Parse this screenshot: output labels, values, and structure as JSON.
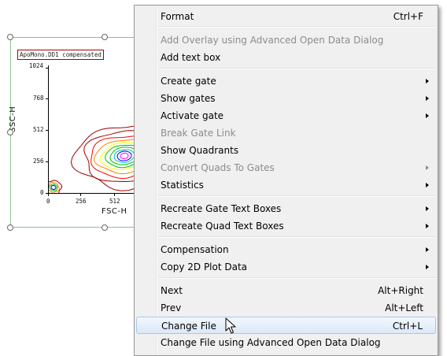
{
  "plot": {
    "title": "ApoMono.DD1 compensated",
    "xlabel": "FSC-H",
    "ylabel": "SSC-H",
    "x_ticks": [
      "0",
      "256",
      "512"
    ],
    "y_ticks": [
      "1024",
      "768",
      "512",
      "256",
      "0"
    ],
    "contour_colors": [
      "#a00000",
      "#ff0000",
      "#ff8000",
      "#ffff00",
      "#00c000",
      "#00c0c0",
      "#0000ff",
      "#ff00ff"
    ]
  },
  "menu": {
    "items": [
      {
        "label": "Format",
        "shortcut": "Ctrl+F"
      },
      {
        "label": "Add Overlay using Advanced Open Data Dialog",
        "disabled": true
      },
      {
        "label": "Add text box"
      },
      {
        "label": "Create gate",
        "submenu": true
      },
      {
        "label": "Show gates",
        "submenu": true
      },
      {
        "label": "Activate gate",
        "submenu": true
      },
      {
        "label": "Break Gate Link",
        "disabled": true
      },
      {
        "label": "Show Quadrants"
      },
      {
        "label": "Convert Quads To Gates",
        "disabled": true,
        "submenu": true
      },
      {
        "label": "Statistics",
        "submenu": true
      },
      {
        "label": "Recreate Gate Text Boxes",
        "submenu": true
      },
      {
        "label": "Recreate Quad Text Boxes",
        "submenu": true
      },
      {
        "label": "Compensation",
        "submenu": true
      },
      {
        "label": "Copy 2D Plot Data",
        "submenu": true
      },
      {
        "label": "Next",
        "shortcut": "Alt+Right"
      },
      {
        "label": "Prev",
        "shortcut": "Alt+Left"
      },
      {
        "label": "Change File",
        "shortcut": "Ctrl+L",
        "highlighted": true
      },
      {
        "label": "Change File using Advanced Open Data Dialog"
      }
    ]
  }
}
